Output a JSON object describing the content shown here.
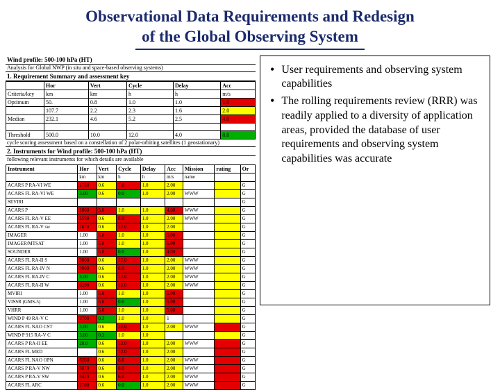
{
  "title_line1": "Observational Data Requirements and Redesign",
  "title_line2": "of the Global Observing System",
  "left": {
    "header1": "Wind profile: 500-100 hPa (HT)",
    "header1_sub": "Analysis for Global NWP (in situ and space-based observing systems)",
    "header2": "1. Requirement Summary and assessment key",
    "req": {
      "cols": [
        "",
        "Hor",
        "Vert",
        "Cycle",
        "Delay",
        "Acc"
      ],
      "units": [
        "Criteria/key",
        "km",
        "km",
        "h",
        "h",
        "m/s"
      ],
      "rows": [
        {
          "label": "Optimum",
          "vals": [
            "50.",
            "0.8",
            "1.0",
            "1.0",
            "1.0"
          ],
          "acc_cell": "red"
        },
        {
          "label": "",
          "vals": [
            "107.7",
            "2.2",
            "2.3",
            "1.6",
            "2.0"
          ],
          "acc_cell": "yel"
        },
        {
          "label": "Median",
          "vals": [
            "232.1",
            "4.6",
            "5.2",
            "2.5",
            "4.0"
          ],
          "acc_cell": "red"
        },
        {
          "label": "",
          "vals": [
            "",
            "",
            "",
            "",
            ""
          ],
          "acc_cell": "blank"
        },
        {
          "label": "Threshold",
          "vals": [
            "500.0",
            "10.0",
            "12.0",
            "4.0",
            "8.0"
          ],
          "acc_cell": "grn"
        }
      ]
    },
    "midline": "cycle scoring assessment based on a constellation of 2 polar-orbiting satellites (1 geostationary)",
    "header3": "2. Instruments for Wind profile: 500-100 hPa (HT)",
    "header3_sub": "following relevant instruments for which details are available",
    "inst": {
      "cols": [
        "Instrument",
        "Hor",
        "Vert",
        "Cycle",
        "Delay",
        "Acc",
        "Mission",
        "rating",
        "Or"
      ],
      "units": [
        "",
        "km",
        "km",
        "h",
        "h",
        "m/s",
        "name",
        "",
        ""
      ],
      "rows": [
        {
          "cells": [
            "ACARS P RA-VI WE",
            "1750",
            "0.6",
            "7.0",
            "1.0",
            "2.00",
            "",
            "",
            " G"
          ],
          "col": [
            "",
            "r",
            "y",
            "r",
            "y",
            "y",
            "",
            "y",
            ""
          ]
        },
        {
          "cells": [
            "ACARS FL RA-VI WE",
            "3.00",
            "0.6",
            "0.0",
            "1.0",
            "2.00",
            "WWW",
            "",
            " G"
          ],
          "col": [
            "",
            "g",
            "y",
            "g",
            "y",
            "y",
            "",
            "y",
            ""
          ]
        },
        {
          "cells": [
            "SEVIRI",
            "",
            "",
            "",
            "",
            "",
            "",
            "",
            " G"
          ],
          "col": [
            "",
            "",
            "",
            "",
            "",
            "",
            "",
            "",
            ""
          ]
        },
        {
          "cells": [
            "ACARS P",
            "1000",
            "5.0",
            "1.0",
            "1.0",
            "4.00",
            "WWW",
            "",
            " G"
          ],
          "col": [
            "",
            "r",
            "r",
            "y",
            "y",
            "r",
            "",
            "y",
            ""
          ]
        },
        {
          "cells": [
            "ACARS FL RA-V EE",
            "1590",
            "0.6",
            "8.0",
            "1.0",
            "2.00",
            "WWW",
            "",
            " G"
          ],
          "col": [
            "",
            "r",
            "y",
            "r",
            "y",
            "y",
            "",
            "y",
            ""
          ]
        },
        {
          "cells": [
            "ACARS FL RA-V sw",
            "1670",
            "0.6",
            "12.0",
            "1.0",
            "2.00",
            "",
            "",
            " G"
          ],
          "col": [
            "",
            "r",
            "y",
            "r",
            "y",
            "y",
            "",
            "y",
            ""
          ]
        },
        {
          "cells": [
            "IMAGER",
            "1.00",
            "5.0",
            "1.0",
            "1.0",
            "5.00",
            "",
            "",
            " G"
          ],
          "col": [
            "",
            "",
            "r",
            "y",
            "y",
            "r",
            "",
            "y",
            ""
          ]
        },
        {
          "cells": [
            "IMAGER/MTSAT",
            "1.00",
            "5.0",
            "1.0",
            "1.0",
            "5.00",
            "",
            "",
            " G"
          ],
          "col": [
            "",
            "",
            "r",
            "y",
            "y",
            "r",
            "",
            "y",
            ""
          ]
        },
        {
          "cells": [
            "SOUNDER",
            "1.00",
            "5.0",
            "0.0",
            "1.0",
            "4.00",
            "",
            "",
            " G"
          ],
          "col": [
            "",
            "",
            "r",
            "g",
            "y",
            "r",
            "",
            "y",
            ""
          ]
        },
        {
          "cells": [
            "ACARS FL RA-II S",
            "3000",
            "0.6",
            "12.0",
            "1.0",
            "2.00",
            "WWW",
            "",
            " G"
          ],
          "col": [
            "",
            "r",
            "y",
            "r",
            "y",
            "y",
            "",
            "y",
            ""
          ]
        },
        {
          "cells": [
            "ACARS FL RA-IV N",
            "3000",
            "0.6",
            "8.0",
            "1.0",
            "2.00",
            "WWW",
            "",
            " G"
          ],
          "col": [
            "",
            "r",
            "y",
            "r",
            "y",
            "y",
            "",
            "y",
            ""
          ]
        },
        {
          "cells": [
            "ACARS FL RA-IV C",
            "3.00",
            "0.6",
            "12.0",
            "1.0",
            "2.00",
            "WWW",
            "",
            " G"
          ],
          "col": [
            "",
            "g",
            "y",
            "r",
            "y",
            "y",
            "",
            "y",
            ""
          ]
        },
        {
          "cells": [
            "ACARS FL RA-II W",
            "6290",
            "0.6",
            "12.0",
            "1.0",
            "2.00",
            "WWW",
            "",
            " G"
          ],
          "col": [
            "",
            "r",
            "y",
            "r",
            "y",
            "y",
            "",
            "y",
            ""
          ]
        },
        {
          "cells": [
            "MVIRI",
            "1.00",
            "5.0",
            "1.0",
            "1.0",
            "5.00",
            "",
            "",
            " G"
          ],
          "col": [
            "",
            "",
            "r",
            "y",
            "y",
            "r",
            "",
            "y",
            ""
          ]
        },
        {
          "cells": [
            "VISSR (GMS-5)",
            "1.00",
            "5.0",
            "0.0",
            "1.0",
            "5.00",
            "",
            "",
            " G"
          ],
          "col": [
            "",
            "",
            "r",
            "g",
            "y",
            "r",
            "",
            "y",
            ""
          ]
        },
        {
          "cells": [
            "VHRR",
            "1.00",
            "5.0",
            "1.0",
            "1.0",
            "5.00",
            "",
            "",
            " G"
          ],
          "col": [
            "",
            "",
            "r",
            "y",
            "y",
            "r",
            "",
            "y",
            ""
          ]
        },
        {
          "cells": [
            "WIND P 49 RA-V C",
            "2700",
            "0.3",
            "1.0",
            "1.0",
            "1",
            "",
            "",
            " G"
          ],
          "col": [
            "",
            "r",
            "g",
            "y",
            "y",
            "",
            "",
            "y",
            ""
          ]
        },
        {
          "cells": [
            "ACARS FL NAO CST",
            "3.00",
            "0.6",
            "12.0",
            "1.0",
            "2.00",
            "WWW",
            "",
            " G"
          ],
          "col": [
            "",
            "g",
            "y",
            "r",
            "y",
            "y",
            "",
            "r",
            ""
          ]
        },
        {
          "cells": [
            "WIND P 915 RA-V C",
            "3.00",
            "0.3",
            "1.0",
            "1.0",
            "",
            "",
            "",
            " G"
          ],
          "col": [
            "",
            "g",
            "g",
            "y",
            "y",
            "",
            "",
            "y",
            ""
          ]
        },
        {
          "cells": [
            "ACARS P RA-II EE",
            "20.0",
            "0.6",
            "12.0",
            "1.0",
            "2.00",
            "WWW",
            "",
            " G"
          ],
          "col": [
            "",
            "g",
            "y",
            "r",
            "y",
            "y",
            "",
            "r",
            ""
          ]
        },
        {
          "cells": [
            "ACARS FL MED",
            "",
            "0.6",
            "12.0",
            "1.0",
            "2.00",
            "",
            "",
            " G"
          ],
          "col": [
            "",
            "",
            "y",
            "r",
            "y",
            "y",
            "",
            "r",
            ""
          ]
        },
        {
          "cells": [
            "ACARS FL NAO OPN",
            "6200",
            "0.6",
            "8.0",
            "1.0",
            "2.00",
            "WWW",
            "",
            " G"
          ],
          "col": [
            "",
            "r",
            "y",
            "r",
            "y",
            "y",
            "",
            "r",
            ""
          ]
        },
        {
          "cells": [
            "ACARS P RA-V NW",
            "3010",
            "0.6",
            "8.0",
            "1.0",
            "2.00",
            "WWW",
            "",
            " G"
          ],
          "col": [
            "",
            "r",
            "y",
            "r",
            "y",
            "y",
            "",
            "r",
            ""
          ]
        },
        {
          "cells": [
            "ACARS P RA-V SW",
            "5440",
            "0.6",
            "6.0",
            "1.0",
            "2.00",
            "WWW",
            "",
            " G"
          ],
          "col": [
            "",
            "r",
            "y",
            "r",
            "y",
            "y",
            "",
            "r",
            ""
          ]
        },
        {
          "cells": [
            "ACARS FL ARC",
            "2700",
            "0.6",
            "0.0",
            "1.0",
            "2.00",
            "WWW",
            "",
            " G"
          ],
          "col": [
            "",
            "r",
            "y",
            "g",
            "y",
            "y",
            "",
            "r",
            ""
          ]
        }
      ]
    }
  },
  "right": {
    "bullet1": "User requirements and observing system capabilities",
    "bullet2": "The rolling requirements review (RRR) was readily applied to a diversity of application areas, provided the database of user requirements and observing system capabilities was accurate"
  }
}
